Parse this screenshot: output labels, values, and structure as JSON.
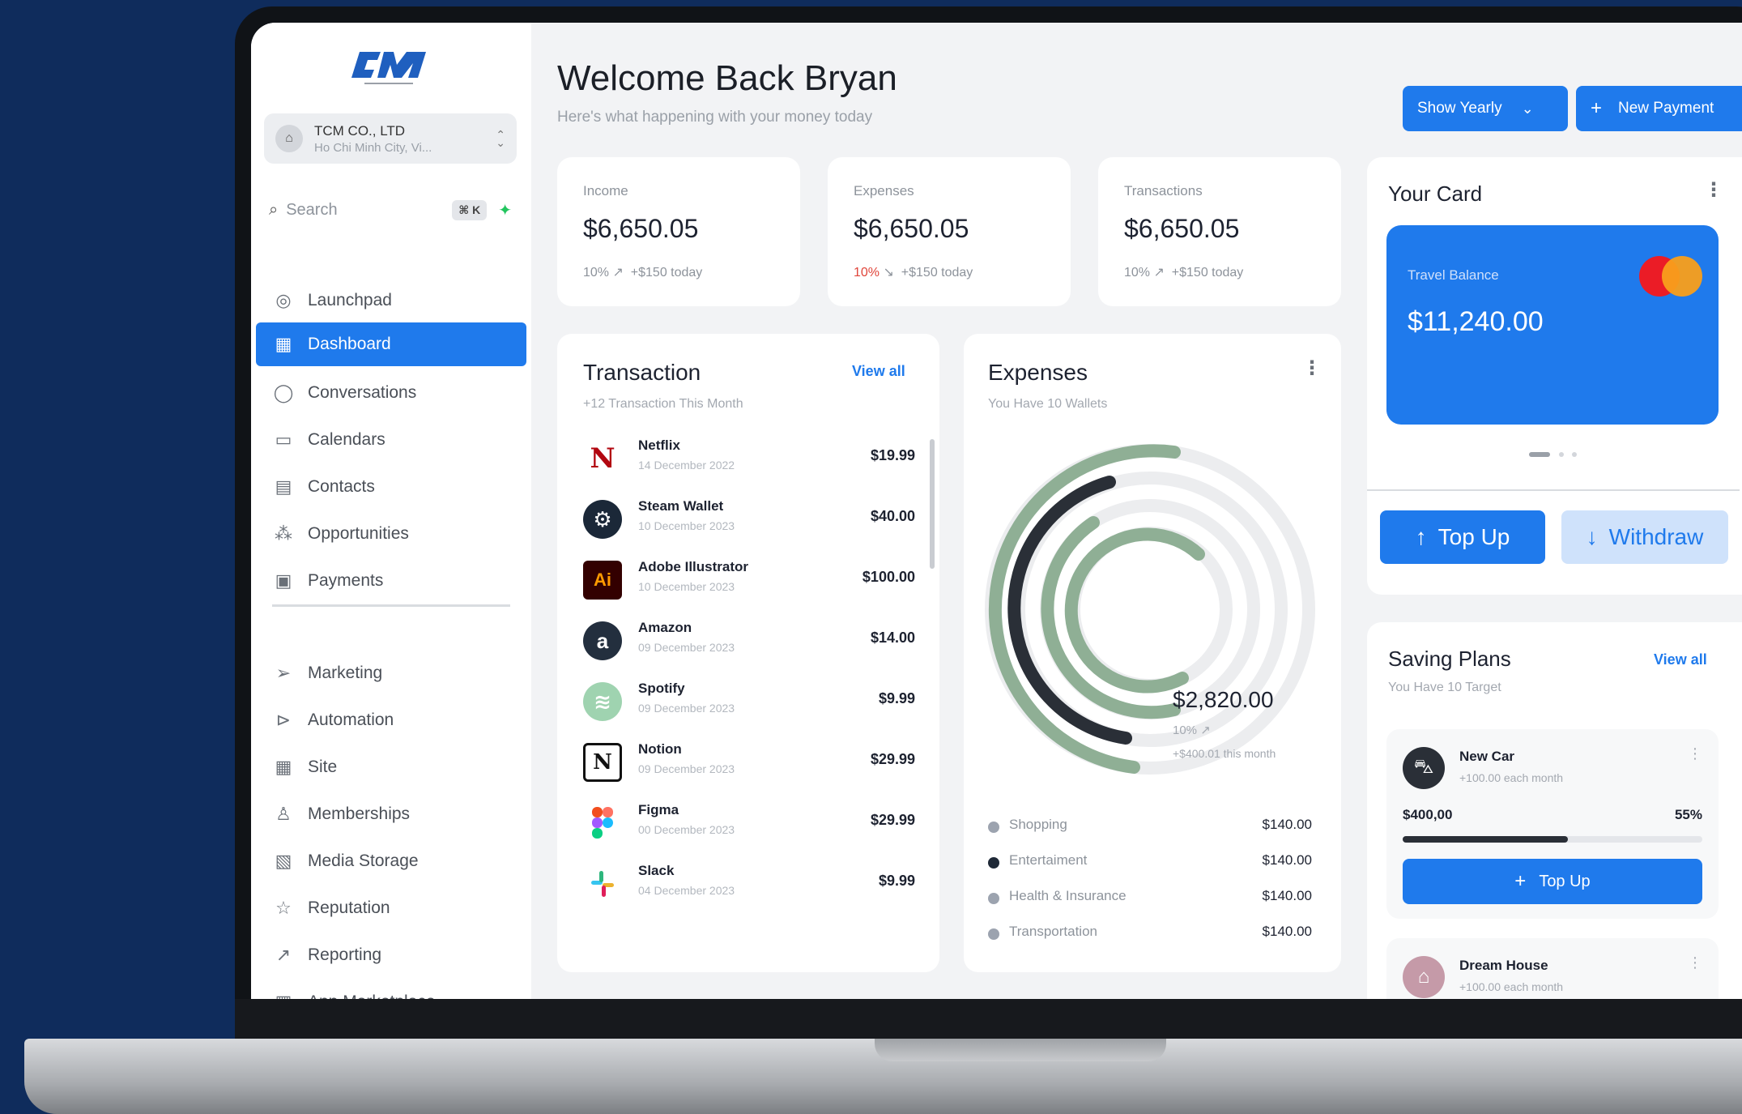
{
  "sidebar": {
    "org": {
      "name": "TCM CO., LTD",
      "location": "Ho Chi Minh City, Vi..."
    },
    "search": {
      "placeholder": "Search",
      "shortcut": "⌘ K"
    },
    "items": [
      {
        "label": "Launchpad",
        "icon": "rocket-icon",
        "active": false
      },
      {
        "label": "Dashboard",
        "icon": "grid-icon",
        "active": true
      },
      {
        "label": "Conversations",
        "icon": "chat-icon",
        "active": false
      },
      {
        "label": "Calendars",
        "icon": "calendar-icon",
        "active": false
      },
      {
        "label": "Contacts",
        "icon": "contact-book-icon",
        "active": false
      },
      {
        "label": "Opportunities",
        "icon": "network-icon",
        "active": false
      },
      {
        "label": "Payments",
        "icon": "receipt-icon",
        "active": false
      },
      {
        "label": "Marketing",
        "icon": "send-icon",
        "active": false
      },
      {
        "label": "Automation",
        "icon": "play-circle-icon",
        "active": false
      },
      {
        "label": "Site",
        "icon": "grid-icon",
        "active": false
      },
      {
        "label": "Memberships",
        "icon": "badge-icon",
        "active": false
      },
      {
        "label": "Media Storage",
        "icon": "image-icon",
        "active": false
      },
      {
        "label": "Reputation",
        "icon": "star-icon",
        "active": false
      },
      {
        "label": "Reporting",
        "icon": "trend-icon",
        "active": false
      },
      {
        "label": "App Marketplace",
        "icon": "apps-icon",
        "active": false
      }
    ]
  },
  "header": {
    "title": "Welcome Back Bryan",
    "subtitle": "Here's what happening with your money today",
    "yearly_button": "Show Yearly",
    "new_payment_button": "New Payment"
  },
  "stats": [
    {
      "label": "Income",
      "value": "$6,650.05",
      "pct": "10%",
      "arrow": "↗",
      "delta": "+$150 today",
      "negative": false
    },
    {
      "label": "Expenses",
      "value": "$6,650.05",
      "pct": "10%",
      "arrow": "↘",
      "delta": "+$150 today",
      "negative": true
    },
    {
      "label": "Transactions",
      "value": "$6,650.05",
      "pct": "10%",
      "arrow": "↗",
      "delta": "+$150 today",
      "negative": false
    }
  ],
  "transactions": {
    "title": "Transaction",
    "subtitle": "+12 Transaction This Month",
    "view_all": "View all",
    "rows": [
      {
        "name": "Netflix",
        "date": "14 December 2022",
        "amount": "$19.99",
        "logo": "N",
        "color": "#b20710",
        "bg": "#ffffff"
      },
      {
        "name": "Steam Wallet",
        "date": "10 December 2023",
        "amount": "$40.00",
        "logo": "S",
        "color": "#ffffff",
        "bg": "#1b2838"
      },
      {
        "name": "Adobe Illustrator",
        "date": "10 December 2023",
        "amount": "$100.00",
        "logo": "Ai",
        "color": "#ff9a00",
        "bg": "#330000"
      },
      {
        "name": "Amazon",
        "date": "09 December 2023",
        "amount": "$14.00",
        "logo": "a",
        "color": "#ffffff",
        "bg": "#232f3e"
      },
      {
        "name": "Spotify",
        "date": "09 December 2023",
        "amount": "$9.99",
        "logo": "≋",
        "color": "#ffffff",
        "bg": "#9fd3b0"
      },
      {
        "name": "Notion",
        "date": "09 December 2023",
        "amount": "$29.99",
        "logo": "N",
        "color": "#111111",
        "bg": "#ffffff"
      },
      {
        "name": "Figma",
        "date": "00 December 2023",
        "amount": "$29.99",
        "logo": "◉",
        "color": "#a259ff",
        "bg": "#ffffff"
      },
      {
        "name": "Slack",
        "date": "04 December 2023",
        "amount": "$9.99",
        "logo": "#",
        "color": "#4a154b",
        "bg": "#ffffff"
      }
    ]
  },
  "expenses": {
    "title": "Expenses",
    "subtitle": "You Have 10 Wallets",
    "amount": "$2,820.00",
    "pct": "10% ↗",
    "month_delta": "+$400.01 this month",
    "legend": [
      {
        "label": "Shopping",
        "value": "$140.00",
        "color": "#9ca3af"
      },
      {
        "label": "Entertaiment",
        "value": "$140.00",
        "color": "#1f2937"
      },
      {
        "label": "Health & Insurance",
        "value": "$140.00",
        "color": "#9ca3af"
      },
      {
        "label": "Transportation",
        "value": "$140.00",
        "color": "#9ca3af"
      }
    ]
  },
  "your_card": {
    "title": "Your Card",
    "card_label": "Travel Balance",
    "balance": "$11,240.00",
    "top_up": "Top Up",
    "withdraw": "Withdraw"
  },
  "saving_plans": {
    "title": "Saving Plans",
    "subtitle": "You Have 10 Target",
    "view_all": "View all",
    "plans": [
      {
        "name": "New Car",
        "sub": "+100.00 each month",
        "amount": "$400,00",
        "pct": "55%",
        "progress": 0.55,
        "button": "Top Up",
        "color": "#2a2f37"
      },
      {
        "name": "Dream House",
        "sub": "+100.00 each month",
        "color": "#c59aa8"
      }
    ]
  },
  "colors": {
    "accent": "#1f7aec",
    "background": "#0f2c5c",
    "ring": "#8faf95",
    "ring_dark": "#2a2f37"
  }
}
